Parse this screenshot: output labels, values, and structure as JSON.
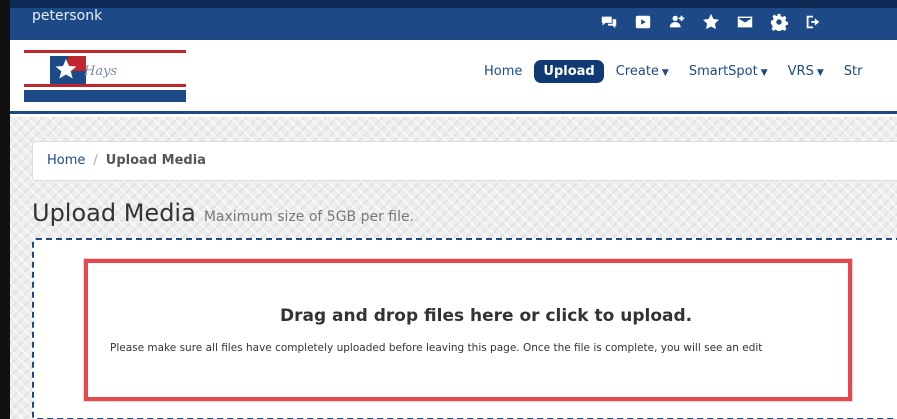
{
  "topbar": {
    "username": "petersonk",
    "icons": [
      "chat-icon",
      "video-icon",
      "user-add-icon",
      "star-icon",
      "mail-icon",
      "gear-icon",
      "logout-icon"
    ]
  },
  "brand": {
    "logo_text": "Hays"
  },
  "nav": {
    "home": "Home",
    "upload": "Upload",
    "create": "Create",
    "smartspot": "SmartSpot",
    "vrs": "VRS",
    "more": "Str"
  },
  "breadcrumb": {
    "home": "Home",
    "separator": "/",
    "current": "Upload Media"
  },
  "page": {
    "title": "Upload Media",
    "subtitle": "Maximum size of 5GB per file."
  },
  "dropzone": {
    "title": "Drag and drop files here or click to upload.",
    "note": "Please make sure all files have completely uploaded before leaving this page. Once the file is complete, you will see an edit"
  },
  "colors": {
    "primary": "#1d4a86",
    "active_nav": "#0f3a73",
    "highlight": "#e5484d",
    "brand_red": "#c0272d"
  }
}
